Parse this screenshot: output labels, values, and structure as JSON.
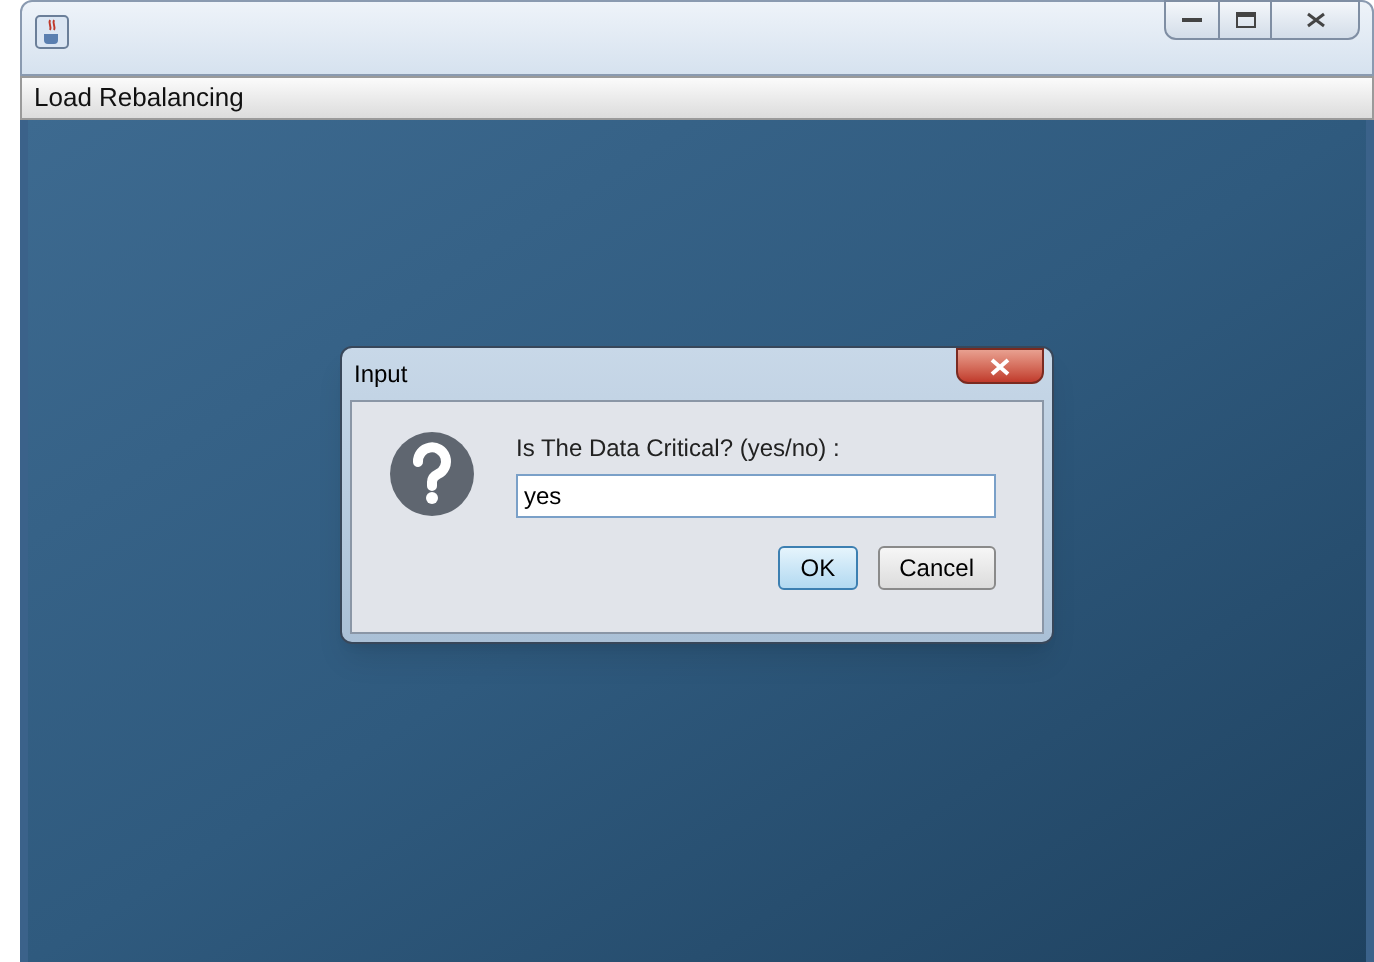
{
  "window": {
    "title": "Load Rebalancing"
  },
  "dialog": {
    "title": "Input",
    "message": "Is The Data Critical? (yes/no) :",
    "field": {
      "value": "yes"
    },
    "buttons": [
      {
        "label": "OK",
        "default": true
      },
      {
        "label": "Cancel",
        "default": false
      }
    ]
  }
}
